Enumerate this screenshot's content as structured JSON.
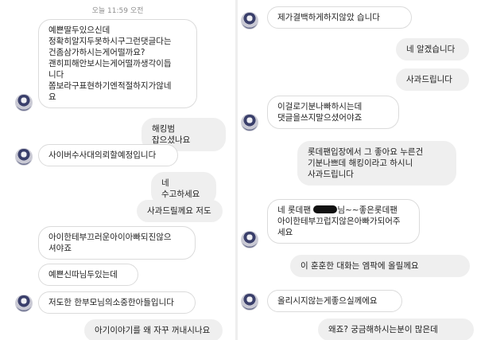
{
  "left": {
    "timestamp": "오늘 11:59 오전",
    "messages": [
      {
        "dir": "in",
        "text": "예쁜딸두있으신데\n정확히알지두못하시구그런댓글다는\n건좀삼가하시는게어떨까요?\n괜히피해안보시는게어떨까생각이듭\n니다\n쫌보라구표현하기엔적절하지가않네\n요"
      },
      {
        "dir": "out",
        "text": "해킹범 잡으셨나요"
      },
      {
        "dir": "in",
        "text": "사이버수사대의뢰할예정입니다"
      },
      {
        "dir": "out",
        "text": "네 수고하세요"
      },
      {
        "dir": "out",
        "text": "사과드릴께요 저도"
      },
      {
        "dir": "in",
        "text": "아이한테부끄러운아이아빠되진않으\n셔야죠"
      },
      {
        "dir": "in",
        "text": "예쁜신따님두있는데"
      },
      {
        "dir": "in",
        "text": "저도한 한부모님의소중한아들입니다"
      },
      {
        "dir": "out",
        "text": "아기이야기를 왜 자꾸 꺼내시나요"
      }
    ]
  },
  "right": {
    "messages": [
      {
        "dir": "in",
        "text": "제가결백하게하지않았 습니다"
      },
      {
        "dir": "out",
        "text": "네 알겠습니다"
      },
      {
        "dir": "out",
        "text": "사과드립니다"
      },
      {
        "dir": "in",
        "text": "이걸로기분나빠하시는데\n댓글을쓰지말으셨어야죠"
      },
      {
        "dir": "out",
        "text": "롯데팬입장에서 그 좋아요 누른건\n기분나쁘데 해킹이라고 하시니\n사과드립니다"
      },
      {
        "dir": "in",
        "pre": "네 롯데팬 ",
        "post": "님~~좋은롯데팬\n아이한테부끄럽지않은아빠가되어주\n세요"
      },
      {
        "dir": "out",
        "text": "이 훈훈한 대화는 엠팍에 올릴께요"
      },
      {
        "dir": "in",
        "text": "올리시지않는게좋으실께에요"
      },
      {
        "dir": "out",
        "text": "왜죠? 궁금해하시는분이 많은데"
      }
    ]
  },
  "icons": {
    "avatar": "profile-photo-baseball-uniform",
    "censor": "redacted-name-mark"
  }
}
